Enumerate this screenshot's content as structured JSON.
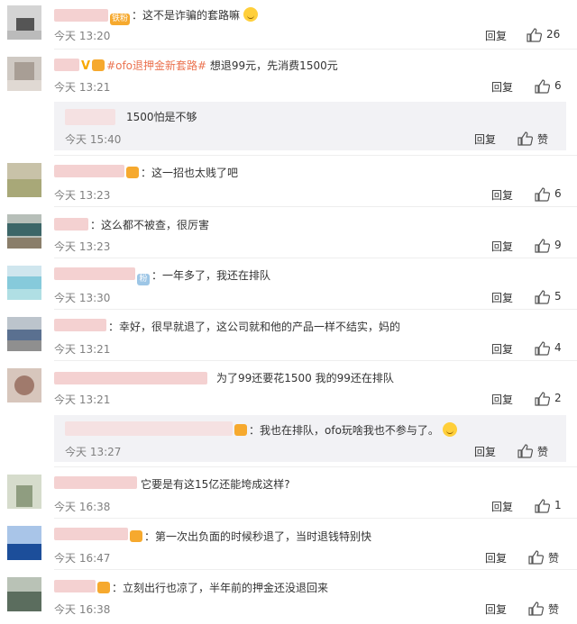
{
  "comments": [
    {
      "text_after": "：这不是诈骗的套路嘛",
      "badge": "铁粉",
      "emoji": "thinking-emoji",
      "time": "今天 13:20",
      "reply": "回复",
      "likes": "26"
    },
    {
      "tag": "#ofo退押金新套路#",
      "text_after": " 想退99元，先消费1500元",
      "vip": "V",
      "time": "今天 13:21",
      "reply": "回复",
      "likes": "6",
      "sub": {
        "text": "1500怕是不够",
        "time": "今天 15:40",
        "reply": "回复",
        "likes": "赞"
      }
    },
    {
      "text_after": "：这一招也太贱了吧",
      "time": "今天 13:23",
      "reply": "回复",
      "likes": "6"
    },
    {
      "text_after": "：这么都不被查，很厉害",
      "time": "今天 13:23",
      "reply": "回复",
      "likes": "9"
    },
    {
      "text_after": "：一年多了，我还在排队",
      "badge": "粉",
      "time": "今天 13:30",
      "reply": "回复",
      "likes": "5"
    },
    {
      "text_after": "：幸好，很早就退了，这公司就和他的产品一样不结实，妈的",
      "time": "今天 13:21",
      "reply": "回复",
      "likes": "4"
    },
    {
      "text_after": "为了99还要花1500 我的99还在排队",
      "time": "今天 13:21",
      "reply": "回复",
      "likes": "2",
      "sub": {
        "text": "：我也在排队，ofo玩啥我也不参与了。",
        "emoji": "grin-emoji",
        "time": "今天 13:27",
        "reply": "回复",
        "likes": "赞"
      }
    },
    {
      "text_after": "它要是有这15亿还能垮成这样?",
      "time": "今天 16:38",
      "reply": "回复",
      "likes": "1"
    },
    {
      "text_after": "：第一次出负面的时候秒退了，当时退钱特别快",
      "time": "今天 16:47",
      "reply": "回复",
      "likes": "赞"
    },
    {
      "text_after": "：立刻出行也凉了，半年前的押金还没退回来",
      "time": "今天 16:38",
      "reply": "回复",
      "likes": "赞"
    }
  ]
}
